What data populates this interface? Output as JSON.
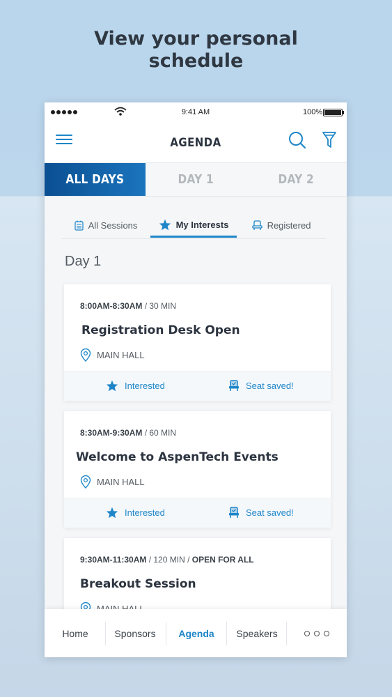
{
  "headline": {
    "line1": "View your personal",
    "line2": "schedule"
  },
  "status_bar": {
    "time": "9:41 AM",
    "battery": "100%"
  },
  "navbar": {
    "title": "AGENDA"
  },
  "day_tabs": [
    {
      "label": "ALL DAYS",
      "active": true
    },
    {
      "label": "DAY 1",
      "active": false
    },
    {
      "label": "DAY 2",
      "active": false
    }
  ],
  "sub_tabs": [
    {
      "label": "All Sessions",
      "icon": "calendar-icon",
      "active": false
    },
    {
      "label": "My Interests",
      "icon": "star-icon",
      "active": true
    },
    {
      "label": "Registered",
      "icon": "seat-icon",
      "active": false
    }
  ],
  "day_heading": "Day 1",
  "sessions": [
    {
      "time": "8:00AM-8:30AM",
      "duration": " / 30 MIN",
      "extra": "",
      "title": "Registration Desk Open",
      "location": "MAIN HALL",
      "interest_label": "Interested",
      "seat_label": "Seat saved!"
    },
    {
      "time": "8:30AM-9:30AM",
      "duration": " / 60 MIN",
      "extra": "",
      "title": "Welcome to AspenTech Events",
      "location": "MAIN HALL",
      "interest_label": "Interested",
      "seat_label": "Seat saved!"
    },
    {
      "time": "9:30AM-11:30AM",
      "duration": " / 120 MIN / ",
      "extra": "OPEN FOR ALL",
      "title": "Breakout Session",
      "location": "MAIN HALL",
      "interest_label": "",
      "seat_label": ""
    }
  ],
  "bottom_nav": [
    {
      "label": "Home",
      "active": false
    },
    {
      "label": "Sponsors",
      "active": false
    },
    {
      "label": "Agenda",
      "active": true
    },
    {
      "label": "Speakers",
      "active": false
    },
    {
      "label": "",
      "icon": "more-icon",
      "active": false
    }
  ],
  "colors": {
    "accent": "#1e86c8",
    "active_tab_start": "#0b4f92",
    "active_tab_end": "#1b75bd",
    "text_dark": "#2c3440"
  }
}
